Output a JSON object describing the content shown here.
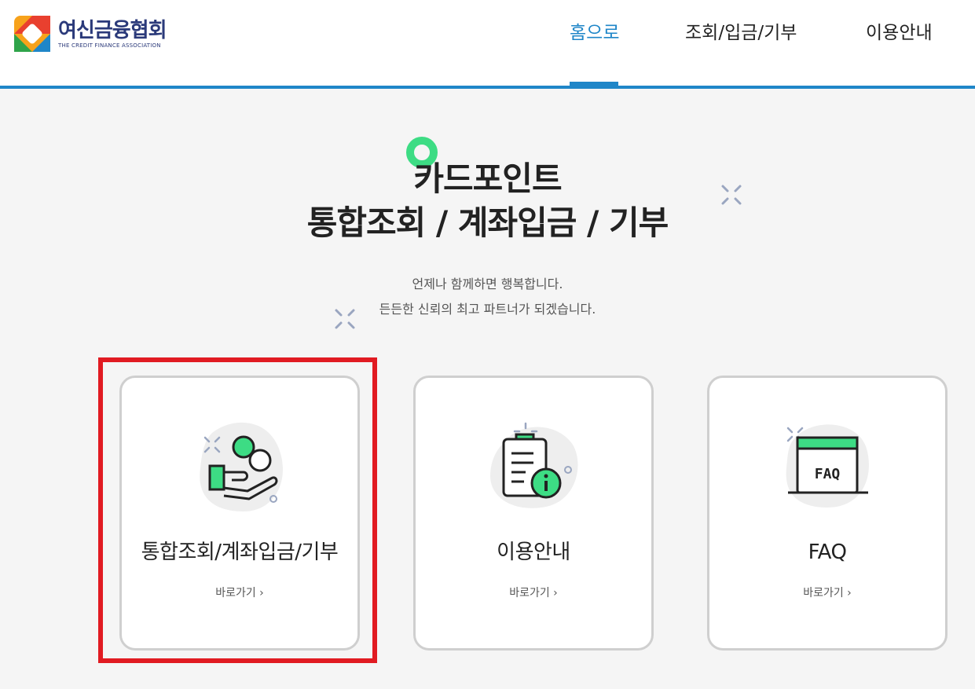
{
  "header": {
    "logo_ko": "여신금융협회",
    "logo_en": "THE CREDIT FINANCE ASSOCIATION"
  },
  "nav": {
    "items": [
      {
        "label": "홈으로",
        "active": true
      },
      {
        "label": "조회/입금/기부",
        "active": false
      },
      {
        "label": "이용안내",
        "active": false
      }
    ]
  },
  "hero": {
    "title_line1": "카드포인트",
    "title_line2": "통합조회 / 계좌입금 / 기부",
    "desc_line1": "언제나 함께하면 행복합니다.",
    "desc_line2": "든든한 신뢰의 최고 파트너가 되겠습니다."
  },
  "cards": [
    {
      "title": "통합조회/계좌입금/기부",
      "link": "바로가기 ›",
      "icon": "coin-hand-icon"
    },
    {
      "title": "이용안내",
      "link": "바로가기 ›",
      "icon": "clipboard-info-icon"
    },
    {
      "title": "FAQ",
      "link": "바로가기 ›",
      "icon": "faq-window-icon",
      "icon_text": "FAQ"
    }
  ],
  "colors": {
    "accent": "#1f86c8",
    "green": "#3ddc84",
    "highlight": "#e11b22"
  }
}
